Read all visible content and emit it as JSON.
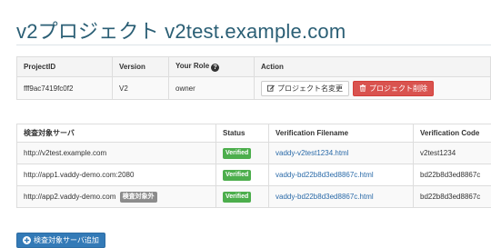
{
  "page": {
    "title": "v2プロジェクト v2test.example.com"
  },
  "project_table": {
    "headers": {
      "project_id": "ProjectID",
      "version": "Version",
      "role": "Your Role",
      "action": "Action"
    },
    "row": {
      "project_id": "fff9ac7419fc0f2",
      "version": "V2",
      "role": "owner"
    },
    "buttons": {
      "rename": "プロジェクト名変更",
      "delete": "プロジェクト削除"
    }
  },
  "server_table": {
    "headers": {
      "server": "検査対象サーバ",
      "status": "Status",
      "filename": "Verification Filename",
      "code": "Verification Code"
    },
    "rows": [
      {
        "server": "http://v2test.example.com",
        "tag": "",
        "status": "Verified",
        "filename": "vaddy-v2test1234.html",
        "code": "v2test1234"
      },
      {
        "server": "http://app1.vaddy-demo.com:2080",
        "tag": "",
        "status": "Verified",
        "filename": "vaddy-bd22b8d3ed8867c.html",
        "code": "bd22b8d3ed8867c"
      },
      {
        "server": "http://app2.vaddy-demo.com",
        "tag": "検査対象外",
        "status": "Verified",
        "filename": "vaddy-bd22b8d3ed8867c.html",
        "code": "bd22b8d3ed8867c"
      }
    ]
  },
  "add_server": {
    "label": "検査対象サーバ追加"
  },
  "colors": {
    "title": "#2b5f75",
    "danger": "#d9534f",
    "primary": "#337ab7",
    "verified": "#4cae4c",
    "excluded": "#8c8c8c",
    "link": "#2a6aa8"
  }
}
